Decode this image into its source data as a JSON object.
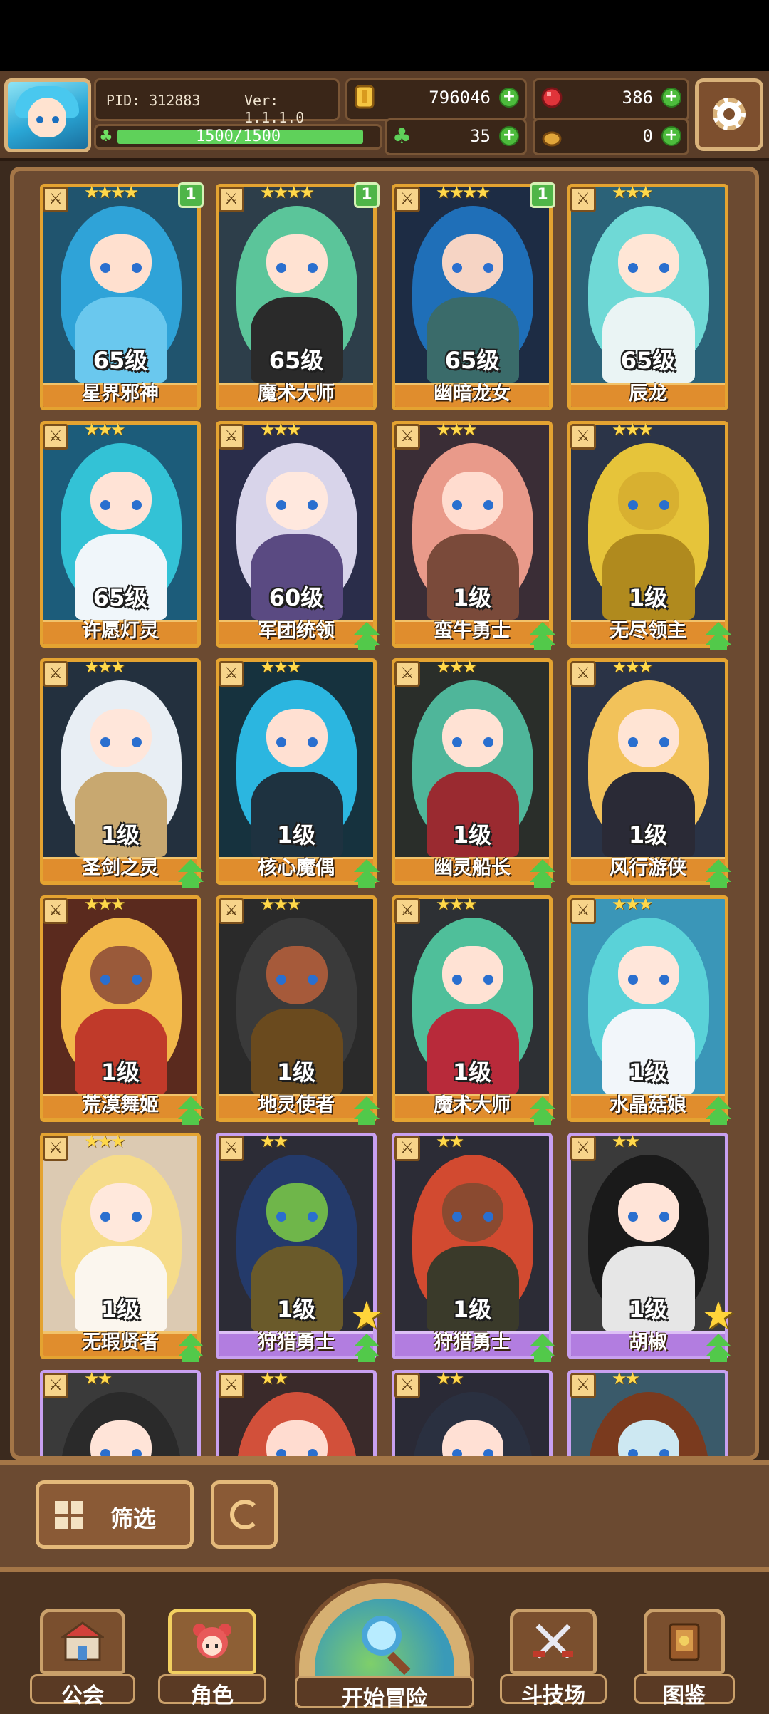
{
  "header": {
    "pid": "PID: 312883",
    "version": "Ver: 1.1.1.0",
    "gold": "796046",
    "gems": "386",
    "clover": "35",
    "bread": "0",
    "xp_text": "1500/1500",
    "xp_progress": 1.0
  },
  "cards": [
    {
      "name": "星界邪神",
      "level": "65级",
      "stars": "★★★★",
      "badge": "1",
      "tier": "gold",
      "hair": "#2fa3d8",
      "skin": "#ffe0cf",
      "body": "#6ac8ee",
      "bg": "#20546e"
    },
    {
      "name": "魔术大师",
      "level": "65级",
      "stars": "★★★★",
      "badge": "1",
      "tier": "gold",
      "hair": "#5bc59a",
      "skin": "#ffe2d2",
      "body": "#2a2a2a",
      "bg": "#2d3e4a"
    },
    {
      "name": "幽暗龙女",
      "level": "65级",
      "stars": "★★★★",
      "badge": "1",
      "tier": "gold",
      "hair": "#1f6fb8",
      "skin": "#f6d4c4",
      "body": "#3a6b6a",
      "bg": "#1d2c44"
    },
    {
      "name": "辰龙",
      "level": "65级",
      "stars": "★★★",
      "badge": "",
      "tier": "gold",
      "hair": "#6fd9d6",
      "skin": "#ffe6d6",
      "body": "#eaf4f4",
      "bg": "#2b6278"
    },
    {
      "name": "许愿灯灵",
      "level": "65级",
      "stars": "★★★",
      "badge": "",
      "tier": "gold",
      "hair": "#33c2d6",
      "skin": "#ffe3d6",
      "body": "#f0f6fa",
      "bg": "#1c5c7a"
    },
    {
      "name": "军团统领",
      "level": "60级",
      "stars": "★★★",
      "badge": "",
      "tier": "gold",
      "hair": "#d8d4ea",
      "skin": "#ffe8de",
      "body": "#5a4a82",
      "bg": "#2a2d4a"
    },
    {
      "name": "蛮牛勇士",
      "level": "1级",
      "stars": "★★★",
      "badge": "",
      "tier": "gold",
      "hair": "#e99a8a",
      "skin": "#ffdccf",
      "body": "#7a4a3a",
      "bg": "#3a2d36"
    },
    {
      "name": "无尽领主",
      "level": "1级",
      "stars": "★★★",
      "badge": "",
      "tier": "gold",
      "hair": "#e6c43a",
      "skin": "#d8b030",
      "body": "#b08a1e",
      "bg": "#2b3448"
    },
    {
      "name": "圣剑之灵",
      "level": "1级",
      "stars": "★★★",
      "badge": "",
      "tier": "gold",
      "hair": "#e8eef4",
      "skin": "#ffe6da",
      "body": "#c8a870",
      "bg": "#23303e"
    },
    {
      "name": "核心魔偶",
      "level": "1级",
      "stars": "★★★",
      "badge": "",
      "tier": "gold",
      "hair": "#2bb6e0",
      "skin": "#ffe0d2",
      "body": "#1e3240",
      "bg": "#16323e"
    },
    {
      "name": "幽灵船长",
      "level": "1级",
      "stars": "★★★",
      "badge": "",
      "tier": "gold",
      "hair": "#4fb69a",
      "skin": "#ffe2d4",
      "body": "#9a2a30",
      "bg": "#2a2e2a"
    },
    {
      "name": "风行游侠",
      "level": "1级",
      "stars": "★★★",
      "badge": "",
      "tier": "gold",
      "hair": "#f2c25a",
      "skin": "#ffe4d4",
      "body": "#2a2a36",
      "bg": "#2a3346"
    },
    {
      "name": "荒漠舞姬",
      "level": "1级",
      "stars": "★★★",
      "badge": "",
      "tier": "gold",
      "hair": "#f2b84a",
      "skin": "#9a5a3a",
      "body": "#c03a2a",
      "bg": "#5a2a1e"
    },
    {
      "name": "地灵使者",
      "level": "1级",
      "stars": "★★★",
      "badge": "",
      "tier": "gold",
      "hair": "#3a3a3a",
      "skin": "#a65a3a",
      "body": "#6a4a1e",
      "bg": "#2a2a2a"
    },
    {
      "name": "魔术大师",
      "level": "1级",
      "stars": "★★★",
      "badge": "",
      "tier": "gold",
      "hair": "#4fbf9a",
      "skin": "#ffe2d4",
      "body": "#b82a3a",
      "bg": "#2d3034"
    },
    {
      "name": "水晶菇娘",
      "level": "1级",
      "stars": "★★★",
      "badge": "",
      "tier": "gold",
      "hair": "#5ad2d8",
      "skin": "#ffe6da",
      "body": "#f2f6fa",
      "bg": "#3a96b8"
    },
    {
      "name": "无瑕贤者",
      "level": "1级",
      "stars": "★★★",
      "badge": "",
      "tier": "gold",
      "hair": "#f6dc8a",
      "skin": "#ffe8dc",
      "body": "#fbf6ee",
      "bg": "#dccab2"
    },
    {
      "name": "狩猎勇士",
      "level": "1级",
      "stars": "★★",
      "badge": "",
      "tier": "purple",
      "hair": "#243a6a",
      "skin": "#6fb64a",
      "body": "#6a5a2a",
      "bg": "#2c2c36"
    },
    {
      "name": "狩猎勇士",
      "level": "1级",
      "stars": "★★",
      "badge": "",
      "tier": "purple",
      "hair": "#d24a30",
      "skin": "#8a4a30",
      "body": "#3a3a2a",
      "bg": "#2c2c36"
    },
    {
      "name": "胡椒",
      "level": "1级",
      "stars": "★★",
      "badge": "",
      "tier": "purple",
      "hair": "#1a1a1a",
      "skin": "#ffe4d8",
      "body": "#e6e6e6",
      "bg": "#3a3a3a"
    },
    {
      "name": "",
      "level": "",
      "stars": "★★",
      "badge": "",
      "tier": "purple",
      "hair": "#2a2a2a",
      "skin": "#ffe4d8",
      "body": "#4a4a4a",
      "bg": "#3a3a3a"
    },
    {
      "name": "",
      "level": "",
      "stars": "★★",
      "badge": "",
      "tier": "purple",
      "hair": "#d2503a",
      "skin": "#ffdcd0",
      "body": "#6a3a2a",
      "bg": "#3a2a2a"
    },
    {
      "name": "",
      "level": "",
      "stars": "★★",
      "badge": "",
      "tier": "purple",
      "hair": "#2a3040",
      "skin": "#ffe0d4",
      "body": "#3a3a4a",
      "bg": "#2a2a36"
    },
    {
      "name": "",
      "level": "",
      "stars": "★★",
      "badge": "",
      "tier": "purple",
      "hair": "#7a3a1e",
      "skin": "#cde8f2",
      "body": "#f4f4f4",
      "bg": "#3a5a6a"
    }
  ],
  "controls": {
    "filter_label": "筛选"
  },
  "nav": {
    "guild": "公会",
    "character": "角色",
    "adventure": "开始冒险",
    "arena": "斗技场",
    "codex": "图鉴"
  }
}
